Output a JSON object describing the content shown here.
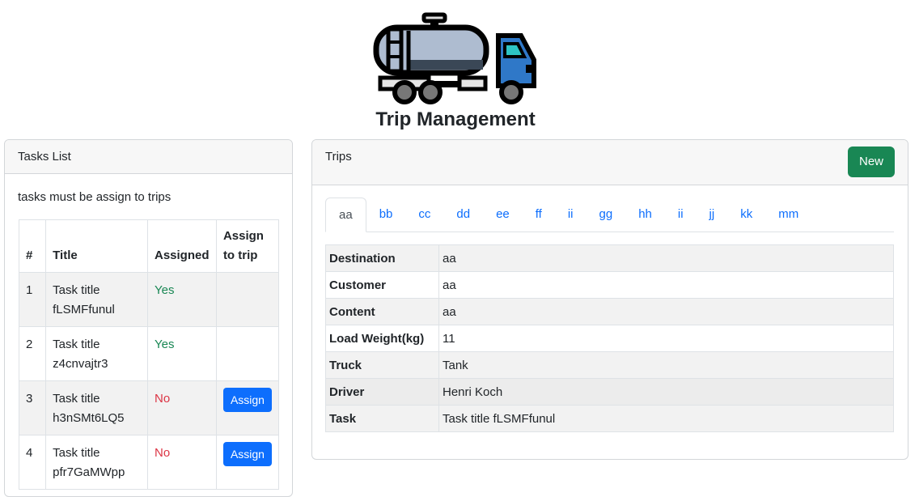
{
  "header": {
    "logo_icon": "tanker-truck-icon",
    "title": "Trip Management"
  },
  "tasks": {
    "card_title": "Tasks List",
    "description": "tasks must be assign to trips",
    "columns": [
      "#",
      "Title",
      "Assigned",
      "Assign to trip"
    ],
    "rows": [
      {
        "num": "1",
        "title": "Task title fLSMFfunul",
        "assigned": "Yes",
        "assign_label": ""
      },
      {
        "num": "2",
        "title": "Task title z4cnvajtr3",
        "assigned": "Yes",
        "assign_label": ""
      },
      {
        "num": "3",
        "title": "Task title h3nSMt6LQ5",
        "assigned": "No",
        "assign_label": "Assign"
      },
      {
        "num": "4",
        "title": "Task title pfr7GaMWpp",
        "assigned": "No",
        "assign_label": "Assign"
      }
    ],
    "colors": {
      "yes": "#198754",
      "no": "#dc3545",
      "assign_button": "#0d6efd"
    }
  },
  "trips": {
    "card_title": "Trips",
    "new_label": "New",
    "tabs": [
      "aa",
      "bb",
      "cc",
      "dd",
      "ee",
      "ff",
      "ii",
      "gg",
      "hh",
      "ii",
      "jj",
      "kk",
      "mm"
    ],
    "active_tab": "aa",
    "details": [
      {
        "key": "Destination",
        "value": "aa"
      },
      {
        "key": "Customer",
        "value": "aa"
      },
      {
        "key": "Content",
        "value": "aa"
      },
      {
        "key": "Load Weight(kg)",
        "value": "11"
      },
      {
        "key": "Truck",
        "value": "Tank"
      },
      {
        "key": "Driver",
        "value": "Henri Koch"
      },
      {
        "key": "Task",
        "value": "Task title fLSMFfunul"
      }
    ],
    "colors": {
      "new_button": "#198754",
      "tab_link": "#0d6efd"
    }
  }
}
